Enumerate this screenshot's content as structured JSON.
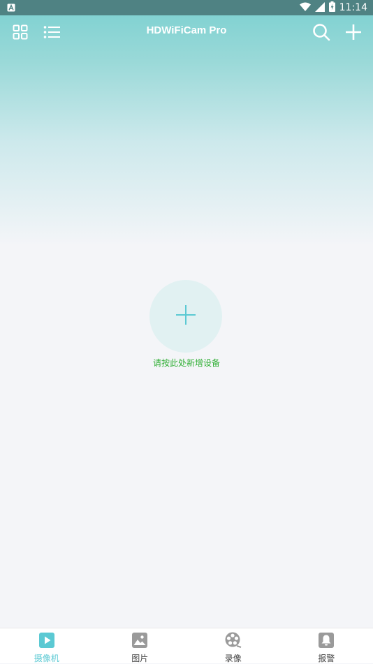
{
  "status_bar": {
    "time": "11:14",
    "icons": [
      "notification-a-icon",
      "wifi-icon",
      "cell-signal-icon",
      "battery-icon"
    ]
  },
  "toolbar": {
    "title": "HDWiFiCam Pro",
    "left_icons": [
      "grid-view-icon",
      "list-view-icon"
    ],
    "right_icons": [
      "search-icon",
      "add-icon"
    ]
  },
  "empty_state": {
    "hint": "请按此处新增设备",
    "icon": "plus-icon"
  },
  "tabbar": {
    "tabs": [
      {
        "label": "摄像机",
        "icon": "camera-play-icon",
        "active": true
      },
      {
        "label": "图片",
        "icon": "image-icon",
        "active": false
      },
      {
        "label": "录像",
        "icon": "film-reel-icon",
        "active": false
      },
      {
        "label": "报警",
        "icon": "bell-icon",
        "active": false
      }
    ]
  },
  "colors": {
    "accent": "#5bc9d3",
    "header_top": "#82d2d2",
    "status_bar": "#4f8283",
    "hint_green": "#2eae33",
    "background": "#f4f5f8"
  }
}
